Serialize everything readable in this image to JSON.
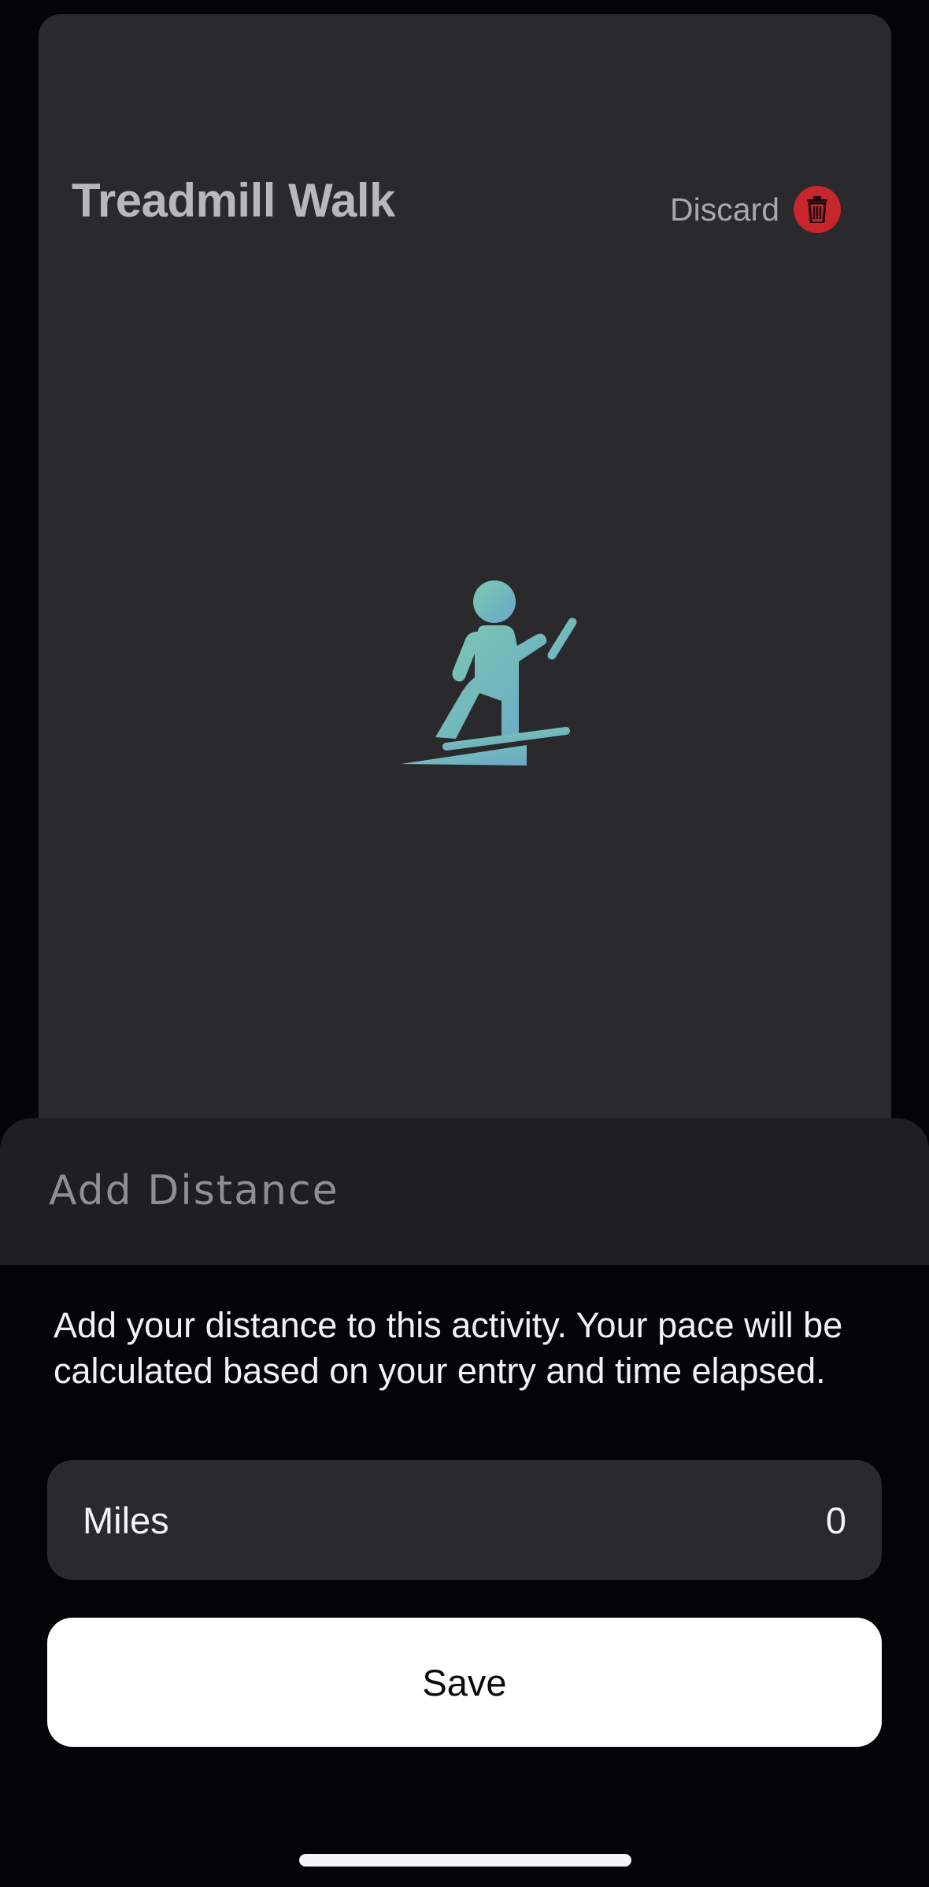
{
  "activity": {
    "title": "Treadmill Walk",
    "discard_label": "Discard",
    "icon": "treadmill-walk-icon"
  },
  "sheet": {
    "title": "Add Distance",
    "description": "Add your distance to this activity. Your pace will be calculated based on your entry and time elapsed.",
    "field": {
      "label": "Miles",
      "value": "0"
    },
    "save_label": "Save"
  },
  "colors": {
    "discard_red": "#c8262d",
    "icon_gradient_start": "#7ccab0",
    "icon_gradient_end": "#6aa6c8",
    "card_bg": "#2a292c",
    "sheet_header_bg": "#1f1e21"
  }
}
